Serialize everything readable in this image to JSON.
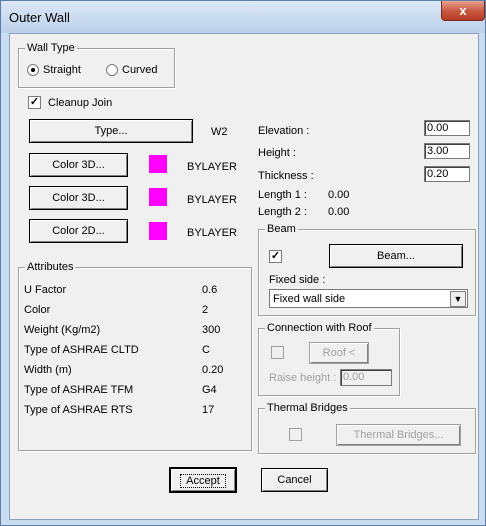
{
  "window": {
    "title": "Outer Wall",
    "close_glyph": "x"
  },
  "wall_type": {
    "title": "Wall Type",
    "straight": "Straight",
    "curved": "Curved"
  },
  "cleanup_join": "Cleanup Join",
  "type_button": "Type...",
  "type_value": "W2",
  "colors": [
    {
      "button": "Color 3D...",
      "value": "BYLAYER",
      "swatch": "#ff00ff"
    },
    {
      "button": "Color 3D...",
      "value": "BYLAYER",
      "swatch": "#ff00ff"
    },
    {
      "button": "Color 2D...",
      "value": "BYLAYER",
      "swatch": "#ff00ff"
    }
  ],
  "attributes": {
    "title": "Attributes",
    "rows": [
      {
        "label": "U Factor",
        "value": "0.6"
      },
      {
        "label": "Color",
        "value": "2"
      },
      {
        "label": "Weight (Kg/m2)",
        "value": "300"
      },
      {
        "label": "Type of ASHRAE CLTD",
        "value": "C"
      },
      {
        "label": "Width (m)",
        "value": "0.20"
      },
      {
        "label": "Type of ASHRAE TFM",
        "value": "G4"
      },
      {
        "label": "Type of ASHRAE RTS",
        "value": "17"
      }
    ]
  },
  "elevation": {
    "label": "Elevation :",
    "value": "0.00"
  },
  "height": {
    "label": "Height :",
    "value": "3.00"
  },
  "thickness": {
    "label": "Thickness :",
    "value": "0.20"
  },
  "length1": {
    "label": "Length 1 :",
    "value": "0.00"
  },
  "length2": {
    "label": "Length 2 :",
    "value": "0.00"
  },
  "beam": {
    "title": "Beam",
    "button": "Beam...",
    "fixed_side_label": "Fixed side :",
    "fixed_side_value": "Fixed wall side"
  },
  "roof": {
    "title": "Connection with Roof",
    "button": "Roof <",
    "raise_label": "Raise height :",
    "raise_value": "0.00"
  },
  "thermal": {
    "title": "Thermal Bridges",
    "button": "Thermal Bridges..."
  },
  "accept": "Accept",
  "cancel": "Cancel"
}
